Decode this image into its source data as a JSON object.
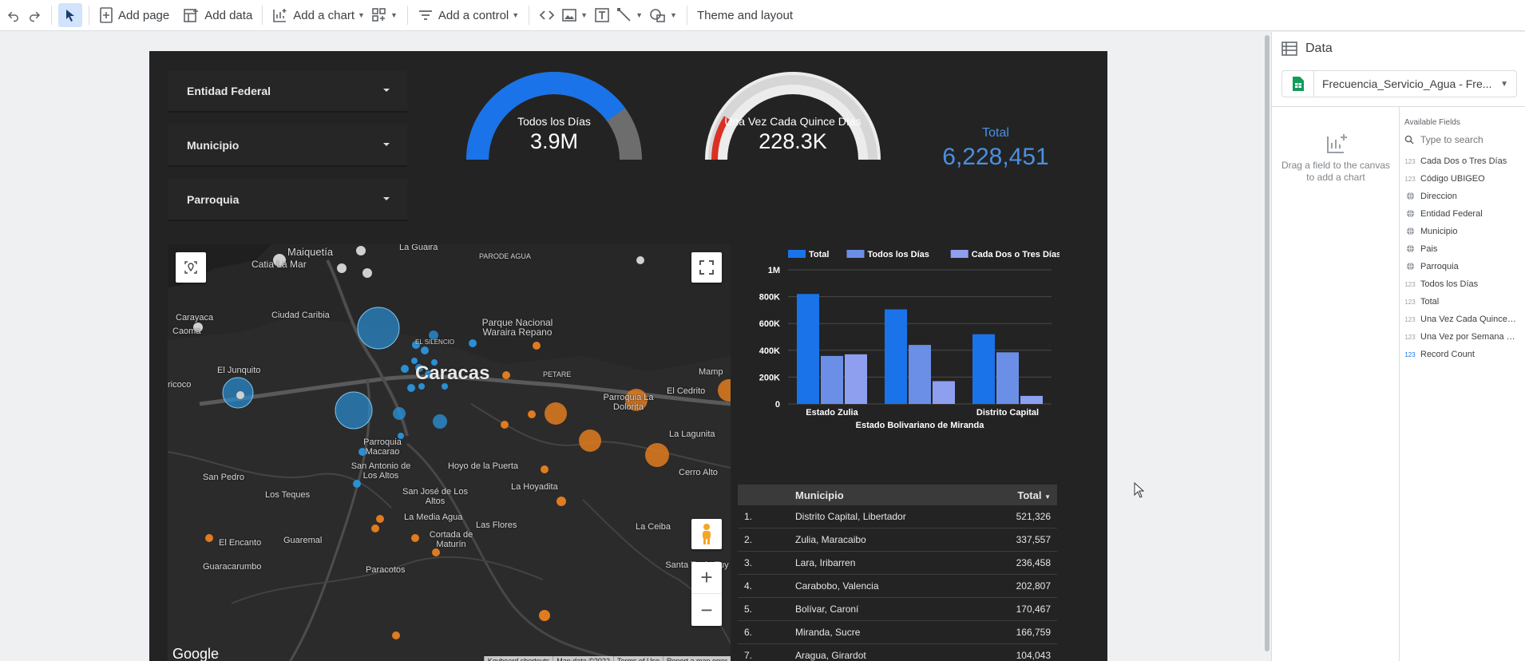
{
  "toolbar": {
    "add_page": "Add page",
    "add_data": "Add data",
    "add_chart": "Add a chart",
    "add_control": "Add a control",
    "theme_layout": "Theme and layout"
  },
  "filters": [
    {
      "label": "Entidad Federal"
    },
    {
      "label": "Municipio"
    },
    {
      "label": "Parroquia"
    }
  ],
  "gauges": [
    {
      "label": "Todos los Días",
      "value": "3.9M",
      "fraction": 0.8,
      "color": "#1a73e8"
    },
    {
      "label": "Una Vez Cada Quince Días",
      "value": "228.3K",
      "fraction": 0.18,
      "color": "#d93025"
    }
  ],
  "scorecard": {
    "label": "Total",
    "value": "6,228,451",
    "color": "#4a90e2"
  },
  "map": {
    "labels": [
      "Maiquetía",
      "La Guaira",
      "PARODE AGUA",
      "Catia La Mar",
      "Carayaca",
      "Caoma",
      "Ciudad Caribia",
      "El Junquito",
      "ricoco",
      "Parque Nacional Waraira Repano",
      "EL SILENCIO",
      "Caracas",
      "PETARE",
      "Mamp",
      "El Cedrito",
      "Parroquia La Dolorita",
      "La Lagunita",
      "Parroquia Macarao",
      "San Pedro",
      "San Antonio de Los Altos",
      "Hoyo de la Puerta",
      "Los Teques",
      "San José de Los Altos",
      "La Hoyadita",
      "Cerro Alto",
      "La Media Agua",
      "Las Flores",
      "Cortada de Maturín",
      "Guaremal",
      "El Encanto",
      "La Ceiba",
      "Guaracarumbo",
      "Paracotos",
      "Santa Te de Tuy"
    ],
    "google": "Google",
    "footer": [
      "Keyboard shortcuts",
      "Map data ©2022",
      "Terms of Use",
      "Report a map error"
    ]
  },
  "chart_data": {
    "type": "bar",
    "categories": [
      "Estado Zulia",
      "Estado Bolivariano de Miranda",
      "Distrito Capital"
    ],
    "series": [
      {
        "name": "Total",
        "values": [
          820000,
          705000,
          520000
        ],
        "color": "#1a73e8"
      },
      {
        "name": "Todos los Días",
        "values": [
          358000,
          440000,
          385000
        ],
        "color": "#6b8fe6"
      },
      {
        "name": "Cada Dos o Tres Días",
        "values": [
          370000,
          170000,
          60000
        ],
        "color": "#8f9ff0"
      }
    ],
    "ylim": [
      0,
      1000000
    ],
    "yticks": [
      "0",
      "200K",
      "400K",
      "600K",
      "800K",
      "1M"
    ],
    "legend": "top",
    "grid": true
  },
  "table": {
    "headers": [
      "Municipio",
      "Total"
    ],
    "rows": [
      [
        "1.",
        "Distrito Capital, Libertador",
        "521,326"
      ],
      [
        "2.",
        "Zulia, Maracaibo",
        "337,557"
      ],
      [
        "3.",
        "Lara, Iribarren",
        "236,458"
      ],
      [
        "4.",
        "Carabobo, Valencia",
        "202,807"
      ],
      [
        "5.",
        "Bolívar, Caroní",
        "170,467"
      ],
      [
        "6.",
        "Miranda, Sucre",
        "166,759"
      ],
      [
        "7.",
        "Aragua, Girardot",
        "104,043"
      ]
    ]
  },
  "datapanel": {
    "title": "Data",
    "source": "Frecuencia_Servicio_Agua - Fre...",
    "drag_hint": "Drag a field to the canvas to add a chart",
    "available_fields": "Available Fields",
    "search_placeholder": "Type to search",
    "fields": [
      {
        "type": "123",
        "name": "Cada Dos o Tres Días"
      },
      {
        "type": "123",
        "name": "Código UBIGEO"
      },
      {
        "type": "geo",
        "name": "Direccion"
      },
      {
        "type": "geo",
        "name": "Entidad Federal"
      },
      {
        "type": "geo",
        "name": "Municipio"
      },
      {
        "type": "geo",
        "name": "Pais"
      },
      {
        "type": "geo",
        "name": "Parroquia"
      },
      {
        "type": "123",
        "name": "Todos los Días"
      },
      {
        "type": "123",
        "name": "Total"
      },
      {
        "type": "123",
        "name": "Una Vez Cada Quince ..."
      },
      {
        "type": "123",
        "name": "Una Vez por Semana (..."
      },
      {
        "type": "123",
        "name": "Record Count"
      }
    ]
  }
}
